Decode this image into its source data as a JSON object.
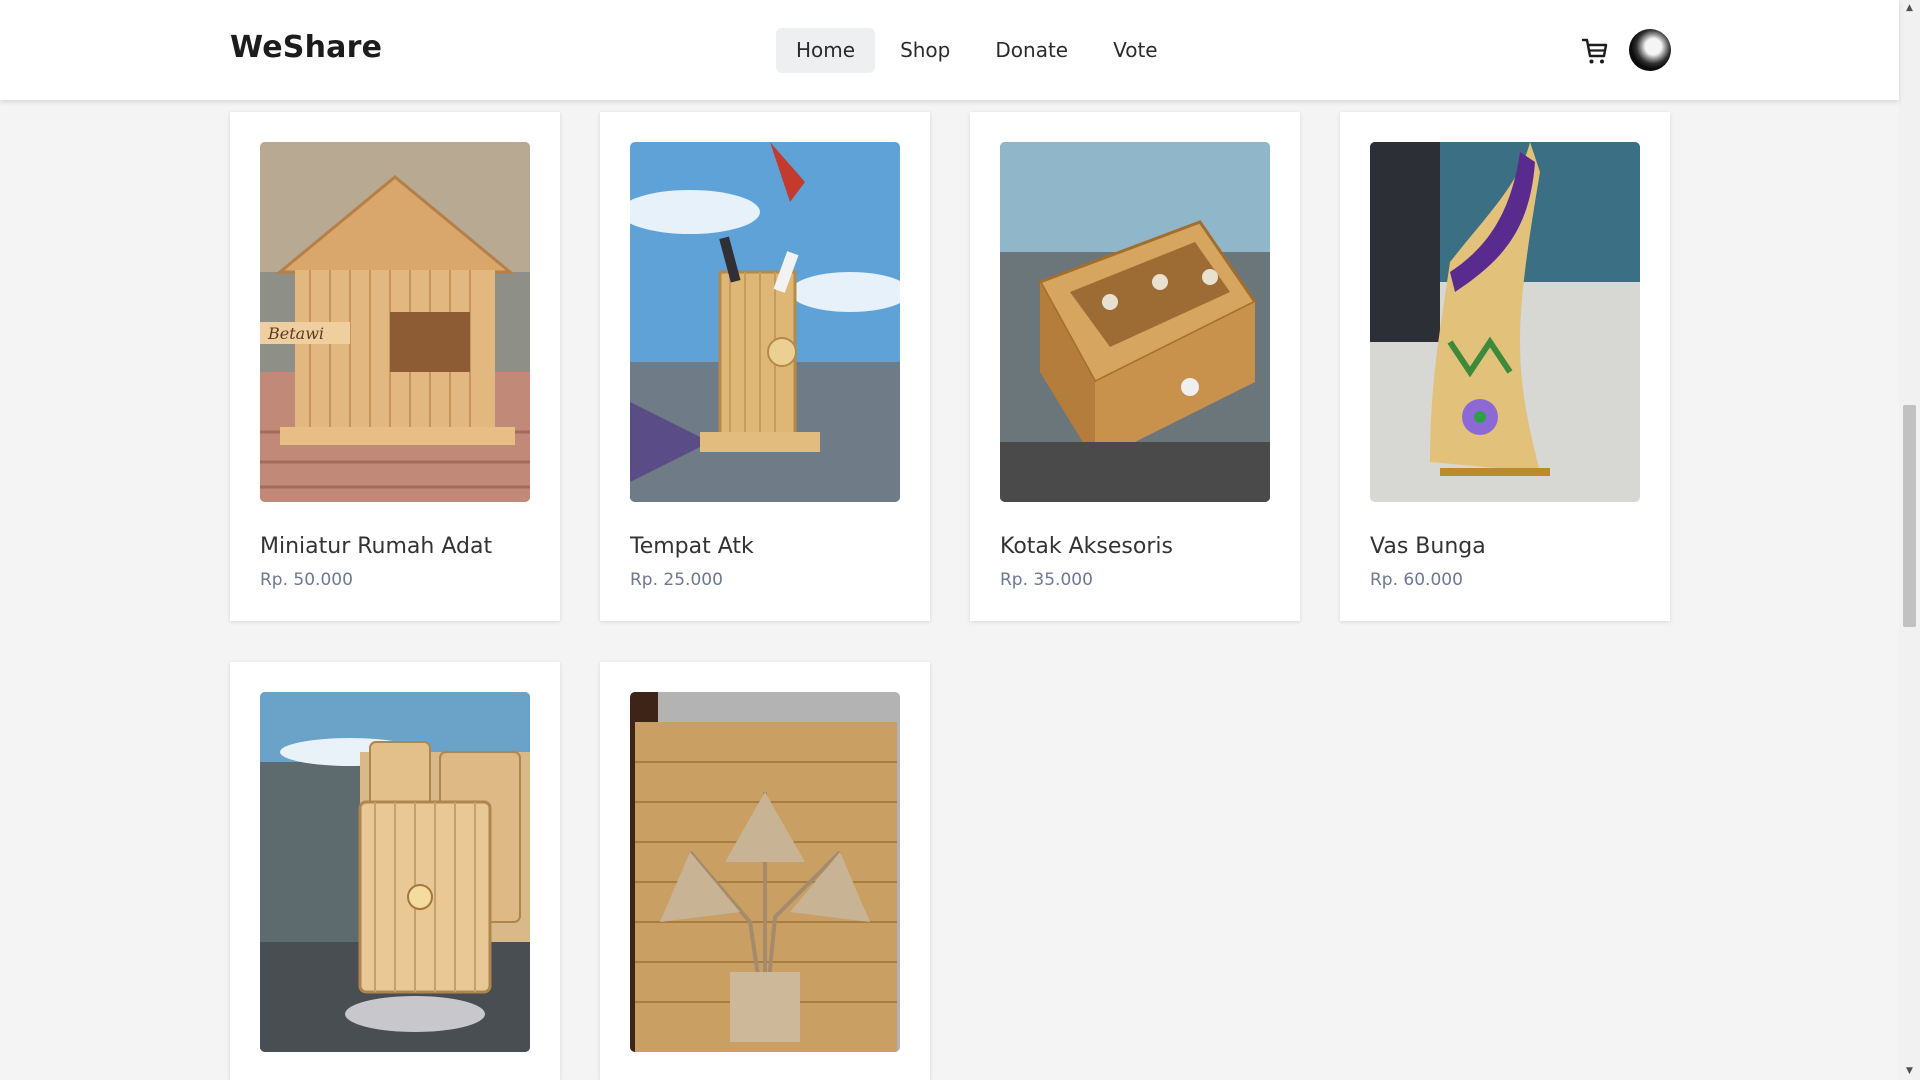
{
  "header": {
    "brand": "WeShare",
    "nav": [
      "Home",
      "Shop",
      "Donate",
      "Vote"
    ],
    "active_nav": "Home"
  },
  "products": [
    {
      "name": "Miniatur Rumah Adat",
      "price": "Rp. 50.000",
      "sign_text": "Betawi"
    },
    {
      "name": "Tempat Atk",
      "price": "Rp. 25.000"
    },
    {
      "name": "Kotak Aksesoris",
      "price": "Rp. 35.000"
    },
    {
      "name": "Vas Bunga",
      "price": "Rp. 60.000"
    },
    {
      "name": "",
      "price": ""
    },
    {
      "name": "",
      "price": ""
    }
  ],
  "icons": {
    "cart": "cart-icon",
    "avatar": "user-avatar",
    "scroll_up": "scroll-up-arrow",
    "scroll_down": "scroll-down-arrow"
  },
  "colors": {
    "page_background": "#f4f4f4",
    "card_background": "#ffffff",
    "price_text": "#6d7891",
    "active_nav_background": "#eeeff1"
  }
}
